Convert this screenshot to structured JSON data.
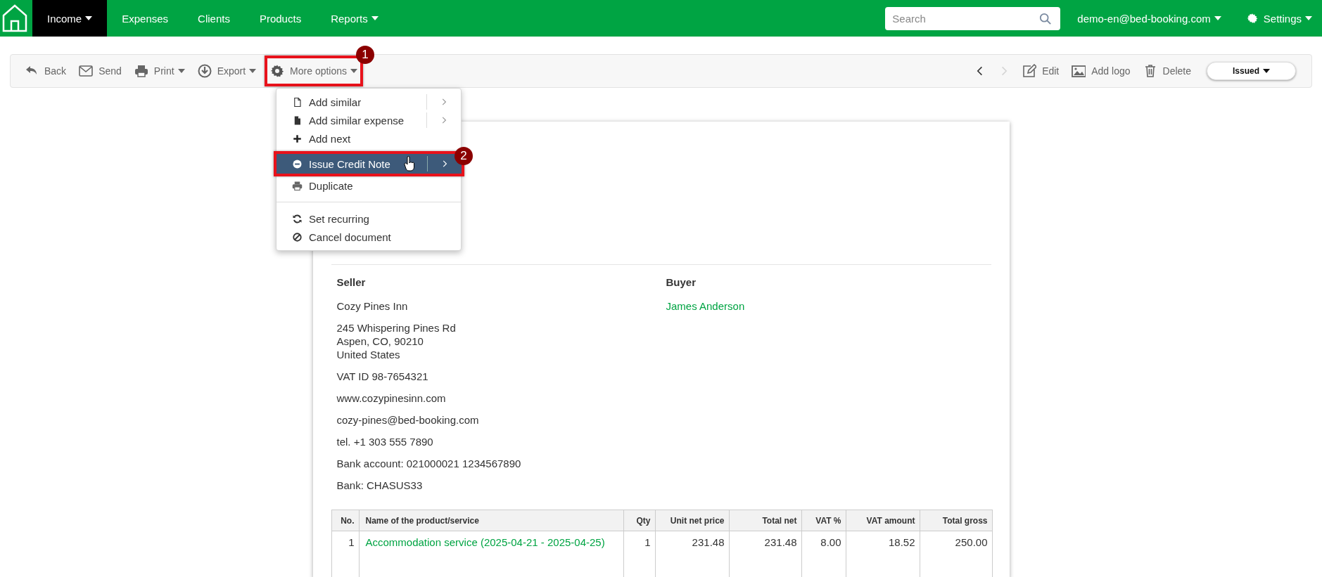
{
  "navbar": {
    "items": [
      {
        "label": "Income",
        "selected": true,
        "caret": true
      },
      {
        "label": "Expenses",
        "selected": false,
        "caret": false
      },
      {
        "label": "Clients",
        "selected": false,
        "caret": false
      },
      {
        "label": "Products",
        "selected": false,
        "caret": false
      },
      {
        "label": "Reports",
        "selected": false,
        "caret": true
      }
    ],
    "search": {
      "placeholder": "Search"
    },
    "account": {
      "label": "demo-en@bed-booking.com"
    },
    "settings": {
      "label": "Settings"
    }
  },
  "toolbar": {
    "left": [
      {
        "label": "Back",
        "caret": false
      },
      {
        "label": "Send",
        "caret": false
      },
      {
        "label": "Print",
        "caret": true
      },
      {
        "label": "Export",
        "caret": true
      },
      {
        "label": "More options",
        "caret": true,
        "callout": "1"
      }
    ],
    "pager": [
      {
        "disabled": false
      },
      {
        "disabled": true
      }
    ],
    "right": [
      {
        "label": "Edit",
        "caret": false
      },
      {
        "label": "Add logo",
        "caret": false
      },
      {
        "label": "Delete",
        "caret": false
      }
    ],
    "status": {
      "label": "Issued"
    }
  },
  "menu": {
    "groups": [
      [
        {
          "label": "Add similar",
          "submenu": true,
          "selected": false
        },
        {
          "label": "Add similar expense",
          "submenu": true,
          "selected": false
        },
        {
          "label": "Add next",
          "submenu": false,
          "selected": false
        },
        {
          "label": "Issue Credit Note",
          "submenu": true,
          "selected": true,
          "callout": "2"
        },
        {
          "label": "Duplicate",
          "submenu": false,
          "selected": false
        }
      ],
      [
        {
          "label": "Set recurring",
          "submenu": false,
          "selected": false
        },
        {
          "label": "Cancel document",
          "submenu": false,
          "selected": false
        }
      ]
    ]
  },
  "document": {
    "seller": {
      "heading": "Seller",
      "name": "Cozy Pines Inn",
      "address": [
        "245 Whispering Pines Rd",
        "Aspen, CO, 90210",
        "United States"
      ],
      "details": [
        "VAT ID 98-7654321",
        "www.cozypinesinn.com",
        "cozy-pines@bed-booking.com",
        "tel. +1 303 555 7890",
        "Bank account: 021000021 1234567890",
        "Bank: CHASUS33"
      ]
    },
    "buyer": {
      "heading": "Buyer",
      "name": "James Anderson"
    },
    "table": {
      "columns": [
        "No.",
        "Name of the product/service",
        "Qty",
        "Unit net price",
        "Total net",
        "VAT %",
        "VAT amount",
        "Total gross"
      ],
      "rows": [
        [
          "1",
          "Accommodation service (2025-04-21 - 2025-04-25)",
          "1",
          "231.48",
          "231.48",
          "8.00",
          "18.52",
          "250.00"
        ]
      ]
    }
  }
}
